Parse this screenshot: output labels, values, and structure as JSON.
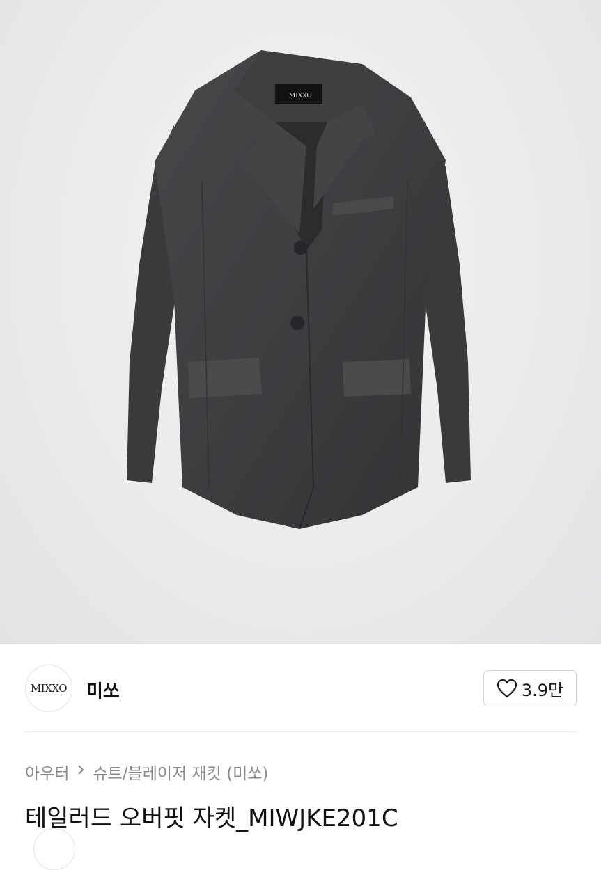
{
  "product": {
    "image_alt": "Dark charcoal tailored oversized jacket",
    "label_text": "MIXXO",
    "title": "테일러드 오버핏 자켓_MIWJKE201C"
  },
  "brand": {
    "logo_text": "MIXXO",
    "name": "미쏘"
  },
  "like": {
    "icon": "heart-outline-icon",
    "count": "3.9만"
  },
  "breadcrumb": {
    "category": "아우터",
    "separator_icon": "chevron-right-icon",
    "subcategory": "슈트/블레이저 재킷 (미쏘)"
  },
  "colors": {
    "jacket": "#3d3d40",
    "background": "#ececee",
    "text_secondary": "#8a8a8a"
  }
}
